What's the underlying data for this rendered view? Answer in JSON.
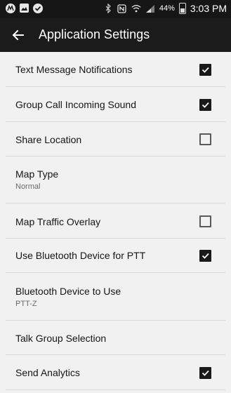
{
  "status_bar": {
    "icons": [
      "moto-icon",
      "image-icon",
      "check-circle-icon",
      "bluetooth-icon",
      "nfc-icon",
      "wifi-icon",
      "signal-icon",
      "battery-icon"
    ],
    "battery": "44%",
    "time": "3:03 PM"
  },
  "appbar": {
    "title": "Application Settings",
    "back_icon": "back-arrow-icon"
  },
  "settings": [
    {
      "title": "Text Message Notifications",
      "subtitle": "",
      "checkbox": true,
      "checked": true
    },
    {
      "title": "Group Call Incoming Sound",
      "subtitle": "",
      "checkbox": true,
      "checked": true
    },
    {
      "title": "Share Location",
      "subtitle": "",
      "checkbox": true,
      "checked": false
    },
    {
      "title": "Map Type",
      "subtitle": "Normal",
      "checkbox": false,
      "checked": false
    },
    {
      "title": "Map Traffic Overlay",
      "subtitle": "",
      "checkbox": true,
      "checked": false
    },
    {
      "title": "Use Bluetooth Device for PTT",
      "subtitle": "",
      "checkbox": true,
      "checked": true
    },
    {
      "title": "Bluetooth Device to Use",
      "subtitle": "PTT-Z",
      "checkbox": false,
      "checked": false
    },
    {
      "title": "Talk Group Selection",
      "subtitle": "",
      "checkbox": false,
      "checked": false
    },
    {
      "title": "Send Analytics",
      "subtitle": "",
      "checkbox": true,
      "checked": true
    }
  ]
}
